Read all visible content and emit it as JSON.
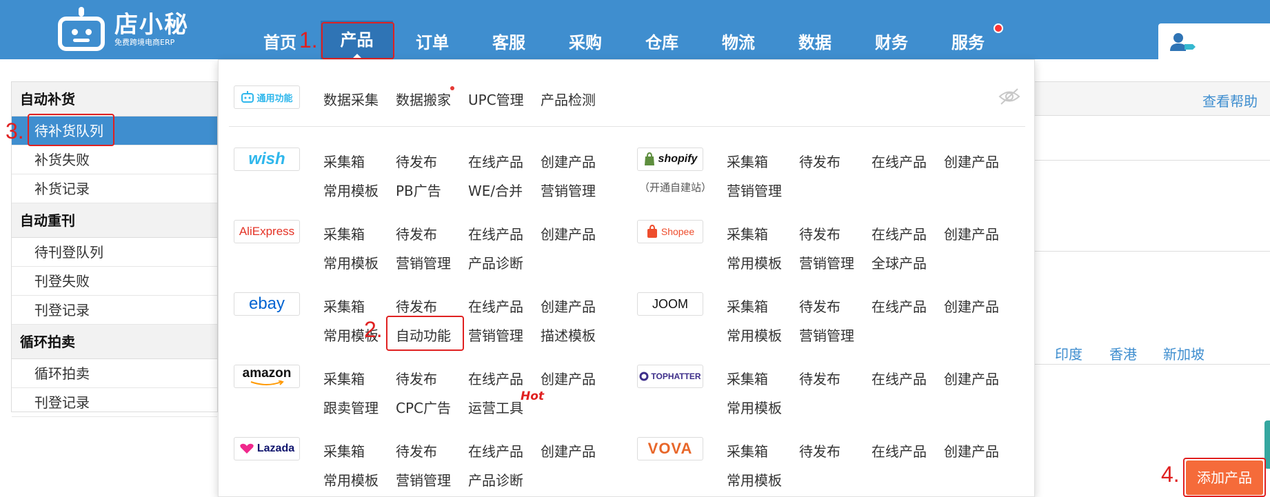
{
  "brand": {
    "name": "店小秘",
    "tagline": "免费跨境电商ERP"
  },
  "nav": {
    "items": [
      "首页",
      "产品",
      "订单",
      "客服",
      "采购",
      "仓库",
      "物流",
      "数据",
      "财务",
      "服务"
    ],
    "active_index": 1
  },
  "annotations": [
    "1.",
    "2.",
    "3.",
    "4."
  ],
  "sidebar": {
    "sections": [
      {
        "title": "自动补货",
        "items": [
          "待补货队列",
          "补货失败",
          "补货记录"
        ]
      },
      {
        "title": "自动重刊",
        "items": [
          "待刊登队列",
          "刊登失败",
          "刊登记录"
        ]
      },
      {
        "title": "循环拍卖",
        "items": [
          "循环拍卖",
          "刊登记录"
        ]
      }
    ],
    "active_item": "待补货队列"
  },
  "right_panel": {
    "help": "查看帮助",
    "regions": [
      "印度",
      "香港",
      "新加坡"
    ],
    "add_product": "添加产品"
  },
  "dropdown": {
    "general": {
      "badge": "通用功能",
      "links": [
        "数据采集",
        "数据搬家",
        "UPC管理",
        "产品检测"
      ]
    },
    "platforms": [
      {
        "badge": "wish",
        "color": "#2fb7ec",
        "row1": [
          "采集箱",
          "待发布",
          "在线产品",
          "创建产品"
        ],
        "row2": [
          "常用模板",
          "PB广告",
          "WE/合并",
          "营销管理"
        ]
      },
      {
        "badge": "AliExpress",
        "color": "#e43225",
        "row1": [
          "采集箱",
          "待发布",
          "在线产品",
          "创建产品"
        ],
        "row2": [
          "常用模板",
          "营销管理",
          "产品诊断"
        ]
      },
      {
        "badge": "ebay",
        "color": "#0064d2",
        "row1": [
          "采集箱",
          "待发布",
          "在线产品",
          "创建产品"
        ],
        "row2": [
          "常用模板",
          "自动功能",
          "营销管理",
          "描述模板"
        ]
      },
      {
        "badge": "amazon",
        "color": "#111111",
        "row1": [
          "采集箱",
          "待发布",
          "在线产品",
          "创建产品"
        ],
        "row2": [
          "跟卖管理",
          "CPC广告",
          "运营工具"
        ],
        "hot": "Hot"
      },
      {
        "badge": "Lazada",
        "color": "#0f146d",
        "row1": [
          "采集箱",
          "待发布",
          "在线产品",
          "创建产品"
        ],
        "row2": [
          "常用模板",
          "营销管理",
          "产品诊断"
        ]
      },
      {
        "badge": "shopify",
        "caption": "（开通自建站）",
        "color": "#111111",
        "row1": [
          "采集箱",
          "待发布",
          "在线产品",
          "创建产品"
        ],
        "row2": [
          "营销管理"
        ]
      },
      {
        "badge": "Shopee",
        "color": "#ee4d2d",
        "row1": [
          "采集箱",
          "待发布",
          "在线产品",
          "创建产品"
        ],
        "row2": [
          "常用模板",
          "营销管理",
          "全球产品"
        ]
      },
      {
        "badge": "JOOM",
        "color": "#111111",
        "row1": [
          "采集箱",
          "待发布",
          "在线产品",
          "创建产品"
        ],
        "row2": [
          "常用模板",
          "营销管理"
        ]
      },
      {
        "badge": "TOPHATTER",
        "color": "#3d2e8a",
        "row1": [
          "采集箱",
          "待发布",
          "在线产品",
          "创建产品"
        ],
        "row2": [
          "常用模板"
        ]
      },
      {
        "badge": "VOVA",
        "color": "#e8672a",
        "row1": [
          "采集箱",
          "待发布",
          "在线产品",
          "创建产品"
        ],
        "row2": [
          "常用模板"
        ]
      }
    ]
  }
}
